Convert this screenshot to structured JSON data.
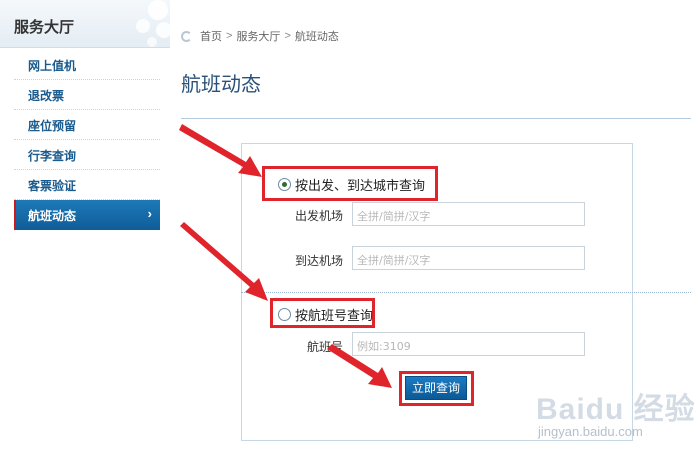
{
  "sidebar": {
    "title": "服务大厅",
    "items": [
      {
        "label": "网上值机"
      },
      {
        "label": "退改票"
      },
      {
        "label": "座位预留"
      },
      {
        "label": "行李查询"
      },
      {
        "label": "客票验证"
      },
      {
        "label": "航班动态"
      }
    ],
    "active_chevron": "›"
  },
  "breadcrumb": {
    "home": "首页",
    "sep1": ">",
    "section": "服务大厅",
    "sep2": ">",
    "current": "航班动态"
  },
  "page": {
    "title": "航班动态"
  },
  "form": {
    "by_city": {
      "label": "按出发、到达城市查询",
      "checked": true,
      "departure_label": "出发机场",
      "departure_placeholder": "全拼/简拼/汉字",
      "arrival_label": "到达机场",
      "arrival_placeholder": "全拼/简拼/汉字"
    },
    "by_flight": {
      "label": "按航班号查询",
      "checked": false,
      "flight_label": "航班号",
      "flight_placeholder": "例如:3109"
    },
    "submit_label": "立即查询"
  },
  "watermark": {
    "logo": "Baidu 经验",
    "url": "jingyan.baidu.com"
  },
  "colors": {
    "accent": "#1670b0",
    "highlight": "#e0242b",
    "title": "#2a5179"
  }
}
